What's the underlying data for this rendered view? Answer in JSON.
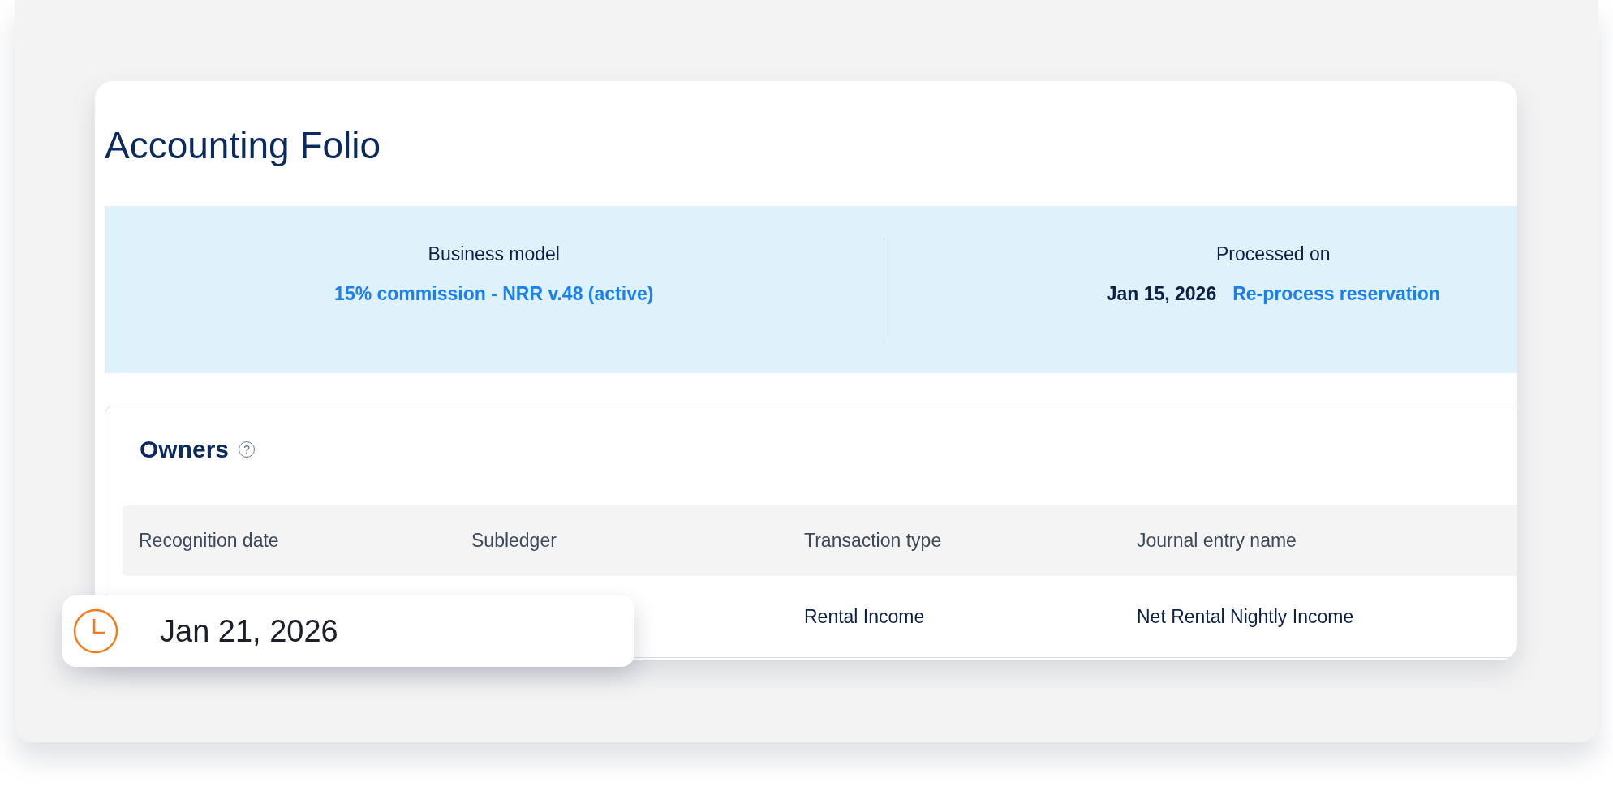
{
  "page": {
    "title": "Accounting Folio"
  },
  "summary": [
    {
      "kind": "link-value",
      "label": "Business model",
      "value": "15% commission - NRR v.48 (active)"
    },
    {
      "kind": "date-action",
      "label": "Processed on",
      "value": "Jan 15, 2026",
      "action": "Re-process reservation"
    }
  ],
  "owners": {
    "title": "Owners",
    "help": "?",
    "columns": [
      "Recognition date",
      "Subledger",
      "Transaction type",
      "Journal entry name"
    ],
    "rows": [
      {
        "transaction_type": "Rental Income",
        "journal_entry_name": "Net Rental Nightly Income"
      }
    ]
  },
  "date_chip": {
    "date": "Jan 21, 2026"
  }
}
